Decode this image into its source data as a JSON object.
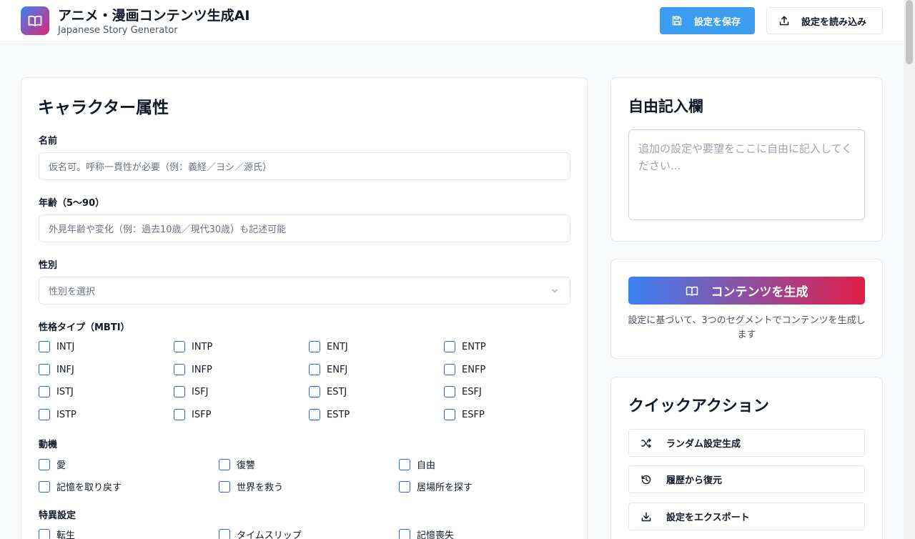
{
  "header": {
    "title": "アニメ・漫画コンテンツ生成AI",
    "subtitle": "Japanese Story Generator",
    "save_label": "設定を保存",
    "load_label": "設定を読み込み"
  },
  "character": {
    "heading": "キャラクター属性",
    "name_label": "名前",
    "name_placeholder": "仮名可。呼称一貫性が必要（例：義経／ヨシ／源氏）",
    "age_label": "年齢（5〜90）",
    "age_placeholder": "外見年齢や変化（例：過去10歳／現代30歳）も記述可能",
    "gender_label": "性別",
    "gender_placeholder": "性別を選択",
    "mbti_label": "性格タイプ（MBTI）",
    "mbti": [
      "INTJ",
      "INTP",
      "ENTJ",
      "ENTP",
      "INFJ",
      "INFP",
      "ENFJ",
      "ENFP",
      "ISTJ",
      "ISFJ",
      "ESTJ",
      "ESFJ",
      "ISTP",
      "ISFP",
      "ESTP",
      "ESFP"
    ],
    "motive_label": "動機",
    "motives": [
      "愛",
      "復讐",
      "自由",
      "記憶を取り戻す",
      "世界を救う",
      "居場所を探す"
    ],
    "special_label": "特異設定",
    "specials": [
      "転生",
      "タイムスリップ",
      "記憶喪失"
    ]
  },
  "free": {
    "heading": "自由記入欄",
    "placeholder": "追加の設定や要望をここに自由に記入してください..."
  },
  "generate": {
    "button_label": "コンテンツを生成",
    "description": "設定に基づいて、3つのセグメントでコンテンツを生成します"
  },
  "quick": {
    "heading": "クイックアクション",
    "random_label": "ランダム設定生成",
    "history_label": "履歴から復元",
    "export_label": "設定をエクスポート"
  },
  "colors": {
    "primary": "#3b9cf0",
    "gradient_start": "#3b82f6",
    "gradient_end": "#e11d48",
    "checkbox": "#2563eb"
  }
}
